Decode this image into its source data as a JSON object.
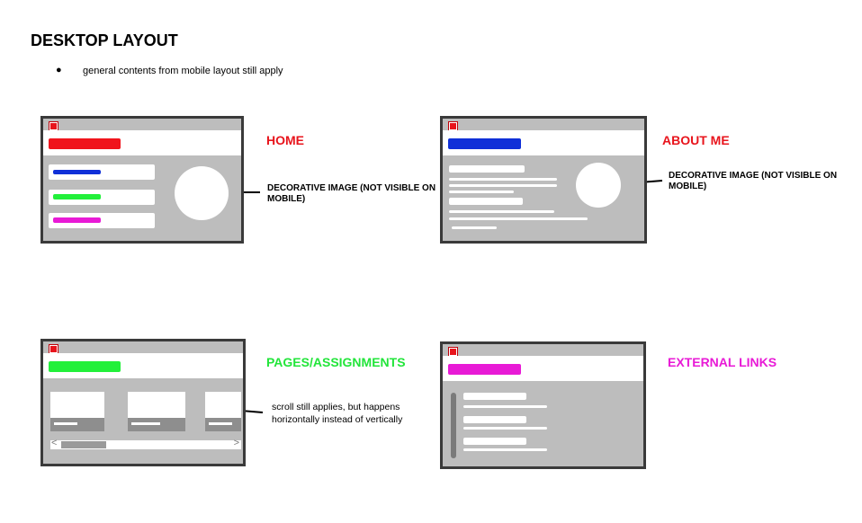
{
  "heading": "DESKTOP LAYOUT",
  "bullet": "general contents from mobile layout still apply",
  "sections": {
    "home": {
      "label": "HOME",
      "color": "#e8141c",
      "note": "DECORATIVE IMAGE (NOT VISIBLE ON MOBILE)"
    },
    "about": {
      "label": "ABOUT ME",
      "color": "#e8141c",
      "note": "DECORATIVE IMAGE (NOT VISIBLE ON MOBILE)"
    },
    "pages": {
      "label": "PAGES/ASSIGNMENTS",
      "color": "#22e53a",
      "note": "scroll still applies, but happens horizontally instead of vertically"
    },
    "links": {
      "label": "EXTERNAL LINKS",
      "color": "#e81ad6"
    }
  },
  "colors": {
    "red": "#f0141c",
    "blue": "#1030d8",
    "green": "#22f03a",
    "magenta": "#e81ad6",
    "panel": "#bdbdbd",
    "frame": "#3a3a3a"
  },
  "scrollbar": {
    "left_arrow": "<",
    "right_arrow": ">"
  }
}
